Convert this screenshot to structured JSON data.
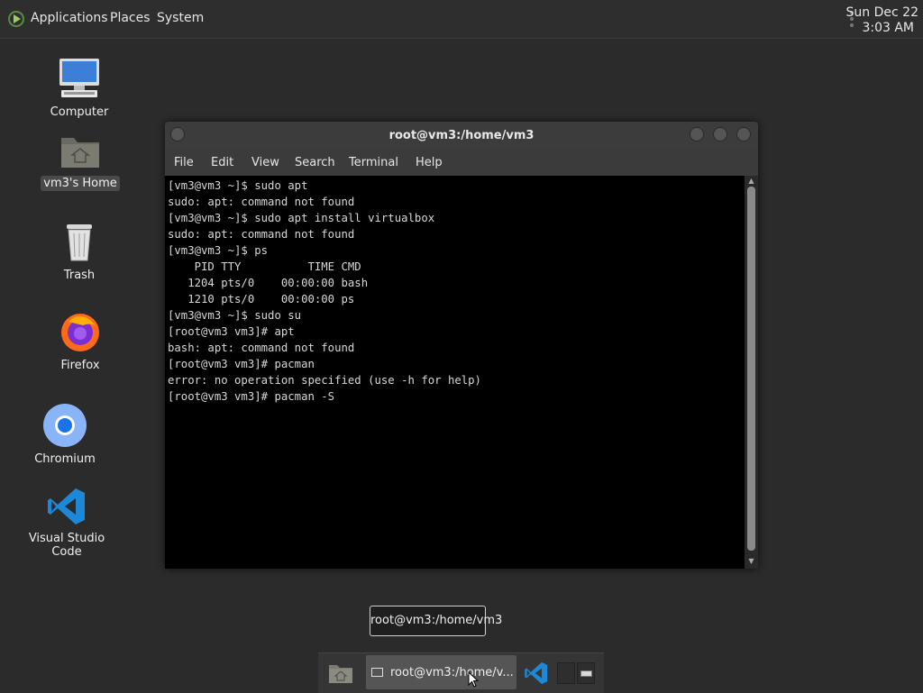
{
  "top_panel": {
    "menu": [
      "Applications",
      "Places",
      "System"
    ],
    "clock_date": "Sun Dec 22",
    "clock_time": "3:03 AM"
  },
  "desktop_icons": [
    {
      "label": "Computer",
      "icon": "computer-icon"
    },
    {
      "label": "vm3's Home",
      "icon": "home-folder-icon"
    },
    {
      "label": "Trash",
      "icon": "trash-icon"
    },
    {
      "label": "Firefox",
      "icon": "firefox-icon"
    },
    {
      "label": "Chromium",
      "icon": "chromium-icon"
    },
    {
      "label": "Visual Studio Code",
      "icon": "vscode-icon"
    }
  ],
  "terminal": {
    "title": "root@vm3:/home/vm3",
    "menu": [
      "File",
      "Edit",
      "View",
      "Search",
      "Terminal",
      "Help"
    ],
    "lines": [
      "[vm3@vm3 ~]$ sudo apt",
      "sudo: apt: command not found",
      "[vm3@vm3 ~]$ sudo apt install virtualbox",
      "sudo: apt: command not found",
      "[vm3@vm3 ~]$ ps",
      "    PID TTY          TIME CMD",
      "   1204 pts/0    00:00:00 bash",
      "   1210 pts/0    00:00:00 ps",
      "[vm3@vm3 ~]$ sudo su",
      "[root@vm3 vm3]# apt",
      "bash: apt: command not found",
      "[root@vm3 vm3]# pacman",
      "error: no operation specified (use -h for help)",
      "[root@vm3 vm3]# pacman -S"
    ]
  },
  "tooltip": "root@vm3:/home/vm3",
  "taskbar": {
    "terminal_label": "root@vm3:/home/v..."
  },
  "colors": {
    "desktop_bg": "#2b2b2b",
    "panel_bg": "#2e2e2e",
    "terminal_bg": "#000000",
    "vscode_blue": "#1e88d8"
  }
}
